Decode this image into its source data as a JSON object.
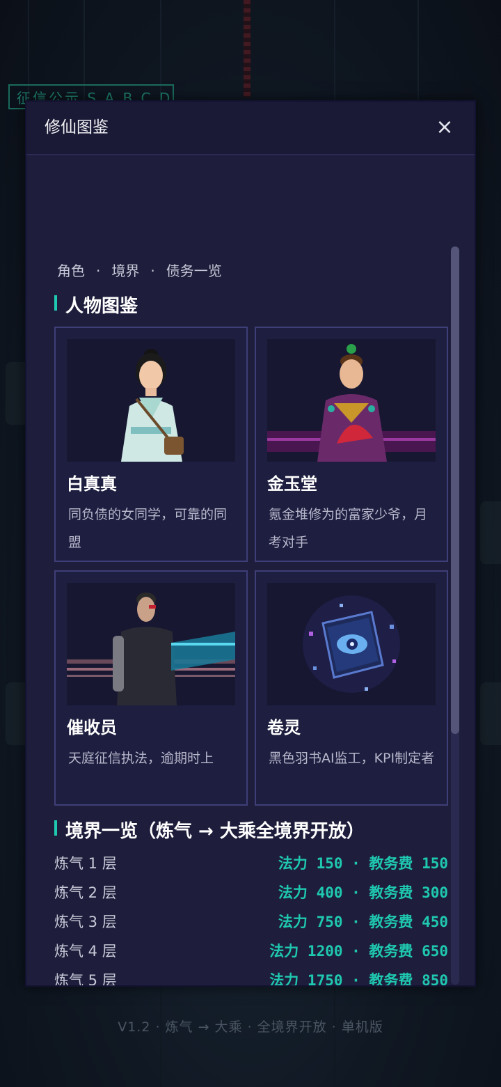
{
  "background": {
    "sign_text": "征信公示 S A B C D E",
    "footer": "V1.2 · 炼气 → 大乘 · 全境界开放 · 单机版"
  },
  "modal": {
    "title": "修仙图鉴",
    "close_label": "×",
    "tagline": [
      "角色",
      "境界",
      "债务一览"
    ],
    "tagline_sep": "·"
  },
  "characters_section": {
    "title": "人物图鉴",
    "cards": [
      {
        "name": "白真真",
        "desc": "同负债的女同学，可靠的同盟",
        "portrait": "girl-student-icon"
      },
      {
        "name": "金玉堂",
        "desc": "氪金堆修为的富家少爷，月考对手",
        "portrait": "rich-young-master-icon"
      },
      {
        "name": "催收员",
        "desc": "天庭征信执法，逾期时上",
        "portrait": "cyborg-collector-icon"
      },
      {
        "name": "卷灵",
        "desc": "黑色羽书AI监工，KPI制定者",
        "portrait": "eye-book-icon"
      }
    ]
  },
  "realms_section": {
    "title": "境界一览（炼气 → 大乘全境界开放）",
    "rows": [
      {
        "realm": "炼气 1 层",
        "stat": "法力 150 · 教务费 150"
      },
      {
        "realm": "炼气 2 层",
        "stat": "法力 400 · 教务费 300"
      },
      {
        "realm": "炼气 3 层",
        "stat": "法力 750 · 教务费 450"
      },
      {
        "realm": "炼气 4 层",
        "stat": "法力 1200 · 教务费 650"
      },
      {
        "realm": "炼气 5 层",
        "stat": "法力 1750 · 教务费 850"
      }
    ]
  },
  "colors": {
    "accent": "#1fc8b0",
    "modal_bg": "#1e1e3c",
    "card_border": "#3e3e78"
  }
}
